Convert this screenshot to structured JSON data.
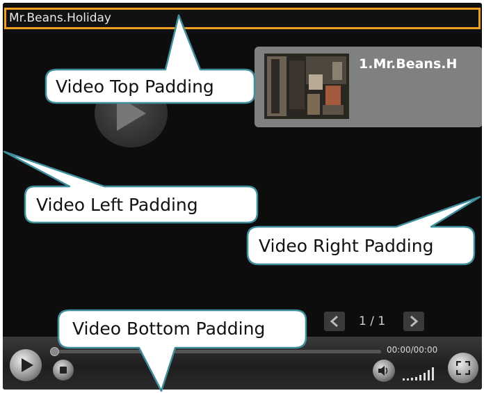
{
  "window": {
    "title": "Mr.Beans.Holiday"
  },
  "playlist": {
    "items": [
      {
        "title": "1.Mr.Beans.H"
      }
    ],
    "pager": {
      "text": "1 / 1"
    }
  },
  "controls": {
    "time_display": "00:00/00:00",
    "progress": 0
  },
  "callouts": {
    "top": "Video Top Padding",
    "left": "Video Left Padding",
    "right": "Video Right Padding",
    "bottom": "Video Bottom Padding"
  },
  "colors": {
    "title_border": "#f0a020",
    "playlist_bg": "#808080",
    "player_bg": "#0f0f0f"
  },
  "icons": [
    "big-play-icon",
    "prev-page-icon",
    "next-page-icon",
    "play-icon",
    "stop-icon",
    "volume-icon",
    "volume-level-icon",
    "fullscreen-icon"
  ]
}
